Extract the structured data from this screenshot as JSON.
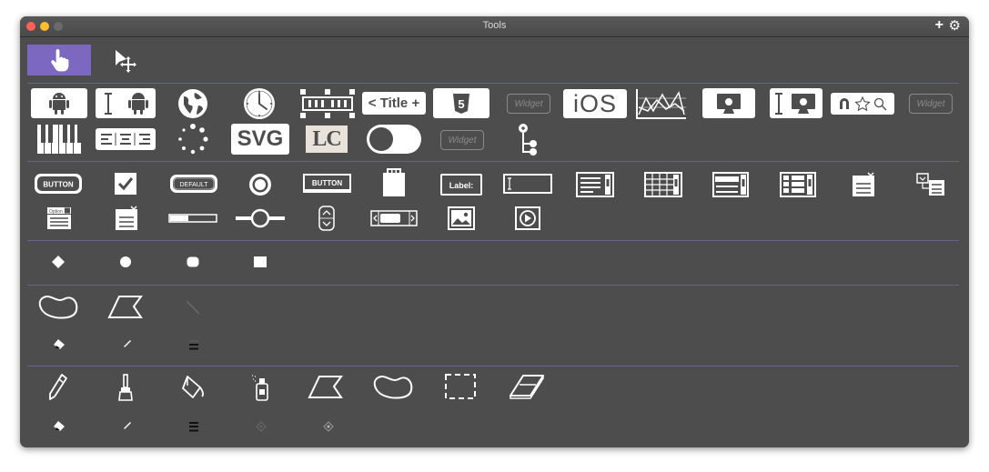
{
  "window": {
    "title": "Tools",
    "controls": [
      "close",
      "minimize",
      "maximize"
    ],
    "titlebar_buttons": {
      "add": "+",
      "settings": "gear-icon"
    }
  },
  "modes": [
    {
      "name": "browse-tool",
      "icon": "pointing-hand-icon",
      "selected": true
    },
    {
      "name": "pointer-tool",
      "icon": "arrow-move-icon",
      "selected": false
    }
  ],
  "widgets": {
    "title_label": "Title",
    "html5_label": "5",
    "widget_label": "Widget",
    "ios_label": "iOS",
    "svg_label": "SVG",
    "lc_label": "LC"
  },
  "controls": {
    "button_label": "BUTTON",
    "default_label": "DEFAULT",
    "button2_label": "BUTTON",
    "field_label": "Label:",
    "combo_label": "Option 1"
  },
  "accent": "#7c68c0"
}
